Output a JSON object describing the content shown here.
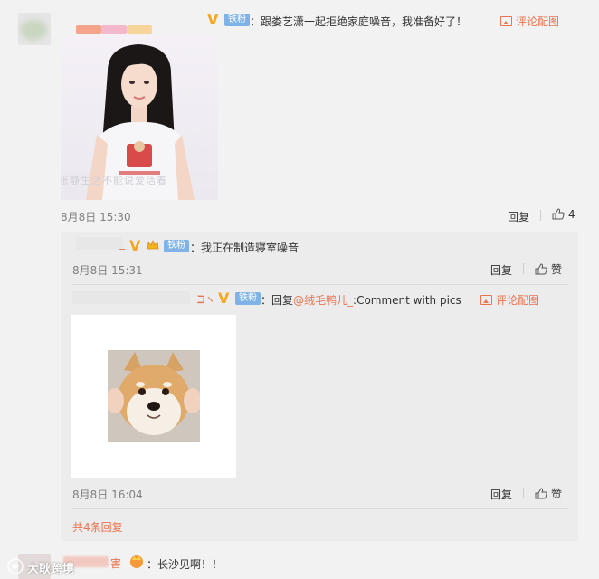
{
  "comment": {
    "badge": "铁粉",
    "v_mark": "V",
    "text": "：跟娄艺潇一起拒绝家庭噪音，我准备好了！",
    "image_link": "评论配图",
    "timestamp": "8月8日 15:30",
    "reply_label": "回复",
    "like_count": "4",
    "photo_caption": "张静生活不能说爱活着"
  },
  "reply1": {
    "name_suffix": "_",
    "v_mark": "V",
    "badge": "铁粉",
    "text": "：我正在制造寝室噪音",
    "timestamp": "8月8日 15:31",
    "reply_label": "回复",
    "like_label": "赞"
  },
  "reply2": {
    "name_glyph": "ℶヽ",
    "v_mark": "V",
    "badge": "铁粉",
    "text_prefix": "：回复",
    "mention": "@绒毛鸭儿_",
    "text_suffix": ":Comment with pics",
    "image_link": "评论配图",
    "timestamp": "8月8日 16:04",
    "reply_label": "回复",
    "like_label": "赞"
  },
  "more_replies": "共4条回复",
  "next_comment": {
    "name_partial": "害",
    "text": "：长沙见啊！！",
    "watermark": "大耿跨境"
  },
  "colors": {
    "accent": "#eb7350",
    "link_blue": "#eb7350",
    "vip_gold": "#f5a623",
    "fan_badge": "#7fb3e8"
  }
}
